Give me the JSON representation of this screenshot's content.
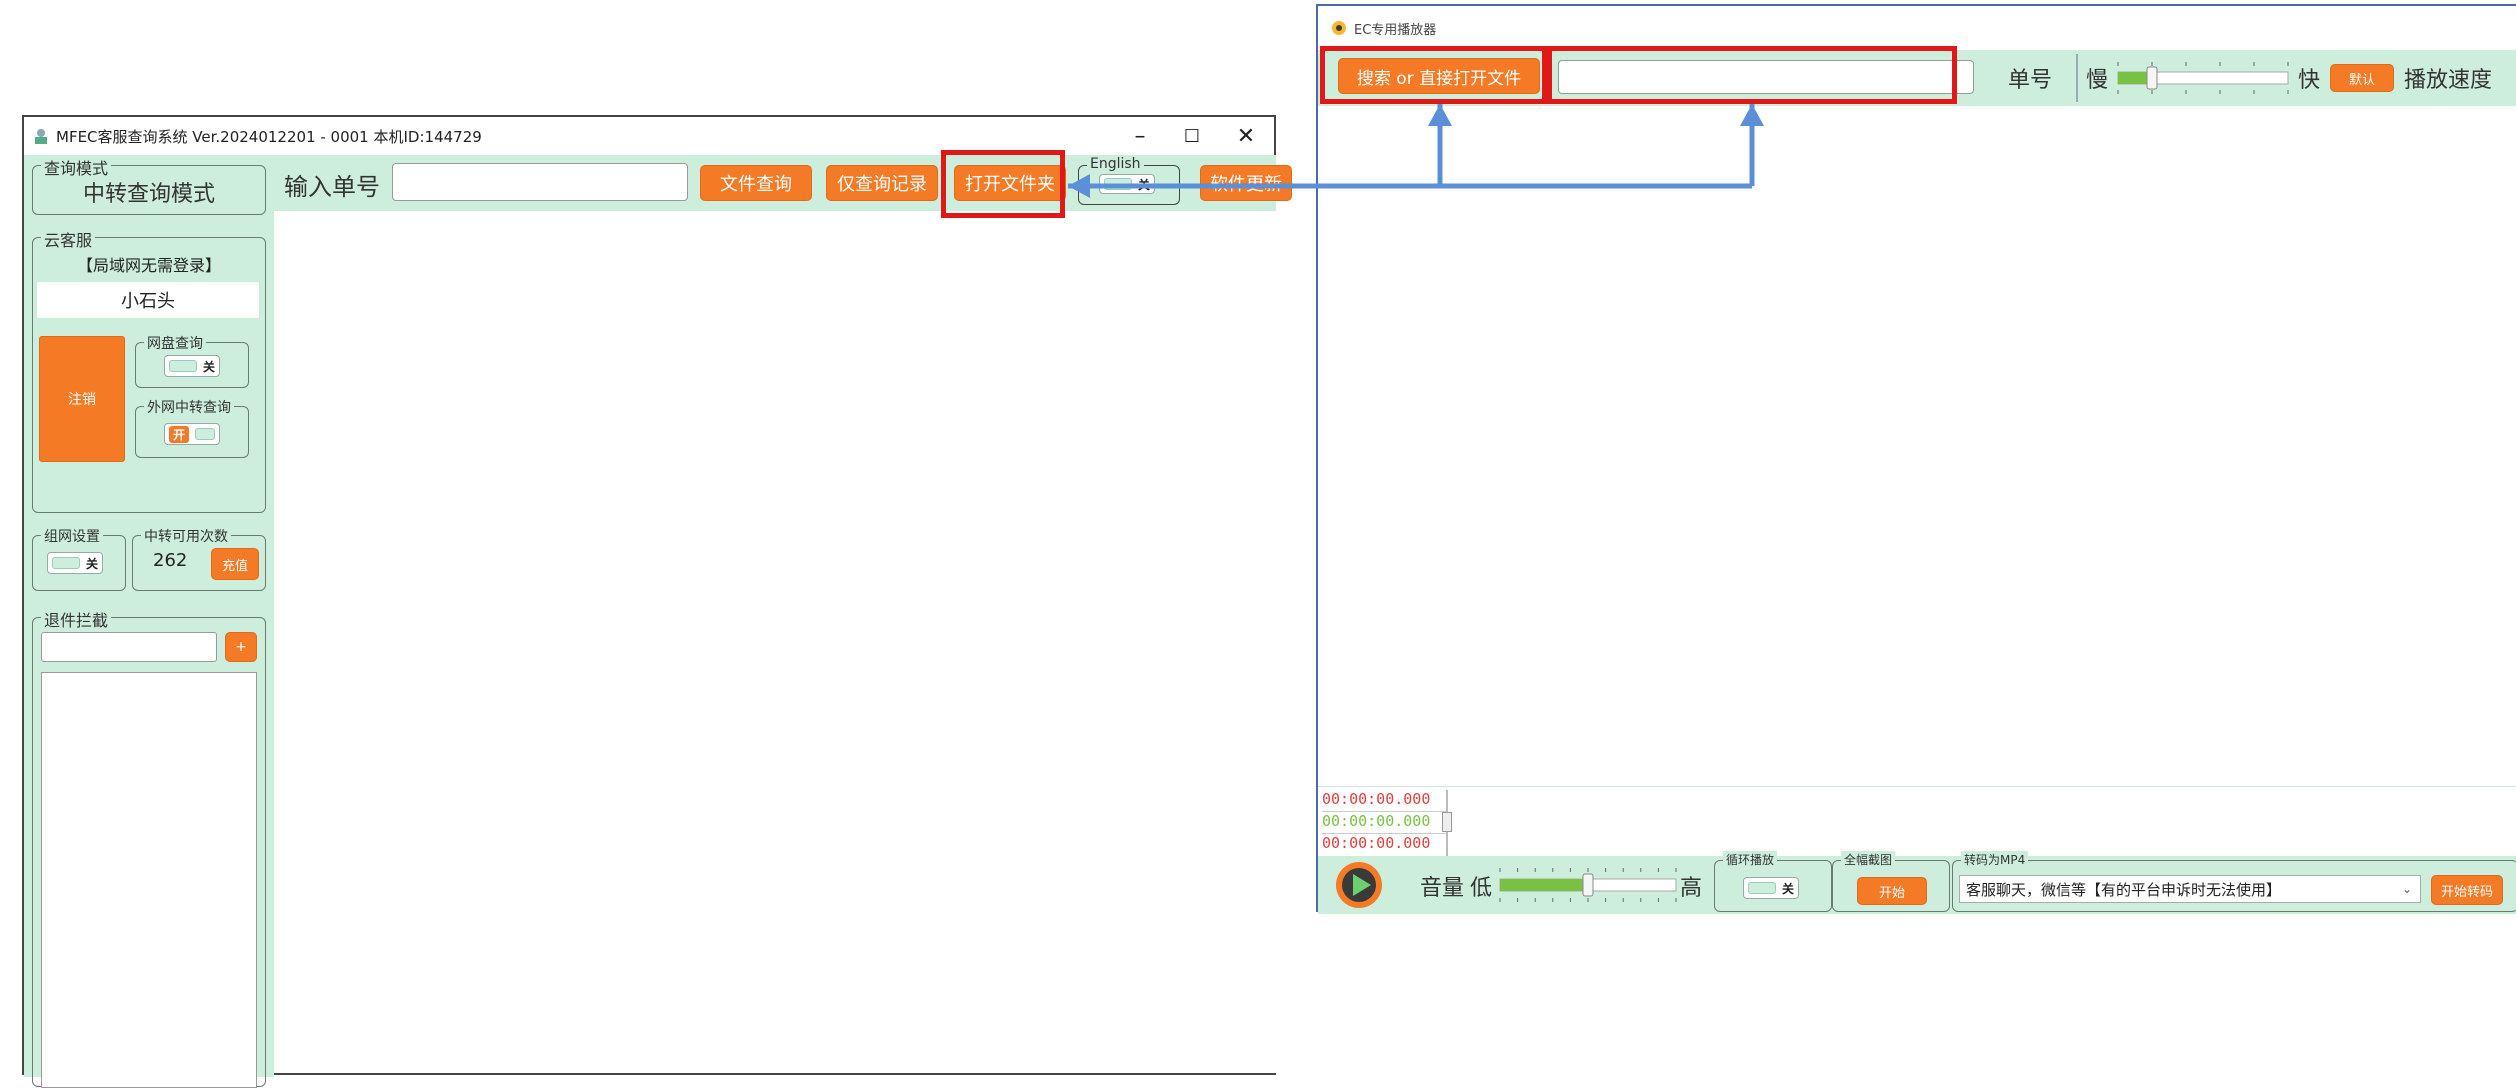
{
  "left_window": {
    "title": "MFEC客服查询系统 Ver.2024012201 - 0001 本机ID:144729",
    "controls": {
      "minimize": "–",
      "maximize": "☐",
      "close": "✕"
    },
    "query_mode": {
      "legend": "查询模式",
      "value": "中转查询模式"
    },
    "topbar": {
      "input_label": "输入单号",
      "input_value": "",
      "file_query_button": "文件查询",
      "record_only_button": "仅查询记录",
      "open_folder_button": "打开文件夹",
      "english_legend": "English",
      "english_toggle": "关",
      "update_button": "软件更新"
    },
    "cloud_service": {
      "legend": "云客服",
      "lan_notice": "【局域网无需登录】",
      "username": "小石头",
      "logout_button": "注销",
      "netdisk": {
        "legend": "网盘查询",
        "state": "关"
      },
      "extranet": {
        "legend": "外网中转查询",
        "state": "开"
      }
    },
    "network": {
      "legend": "组网设置",
      "state": "关"
    },
    "relay_count": {
      "legend": "中转可用次数",
      "value": "262",
      "recharge_button": "充值"
    },
    "intercept": {
      "legend": "退件拦截",
      "input_value": "",
      "add_button": "+"
    }
  },
  "right_window": {
    "title": "EC专用播放器",
    "search_button": "搜索 or 直接打开文件",
    "search_input_value": "",
    "order_label": "单号",
    "slow_label": "慢",
    "fast_label": "快",
    "default_button": "默认",
    "speed_label": "播放速度",
    "speed_level": 0.2,
    "timestamps": [
      "00:00:00.000",
      "00:00:00.000",
      "00:00:00.000"
    ],
    "timestamp_colors": [
      "#e04040",
      "#7ac143",
      "#e04040"
    ],
    "volume_label": "音量",
    "volume_low": "低",
    "volume_high": "高",
    "volume_level": 0.5,
    "loop": {
      "legend": "循环播放",
      "state": "关"
    },
    "screenshot": {
      "legend": "全幅截图",
      "button": "开始"
    },
    "convert": {
      "legend": "转码为MP4",
      "select_value": "客服聊天，微信等【有的平台申诉时无法使用】",
      "button": "开始转码"
    }
  },
  "colors": {
    "accent": "#f47a26",
    "panel_bg": "#cdeedd",
    "highlight": "#e01818",
    "arrow": "#5b8fd8"
  }
}
